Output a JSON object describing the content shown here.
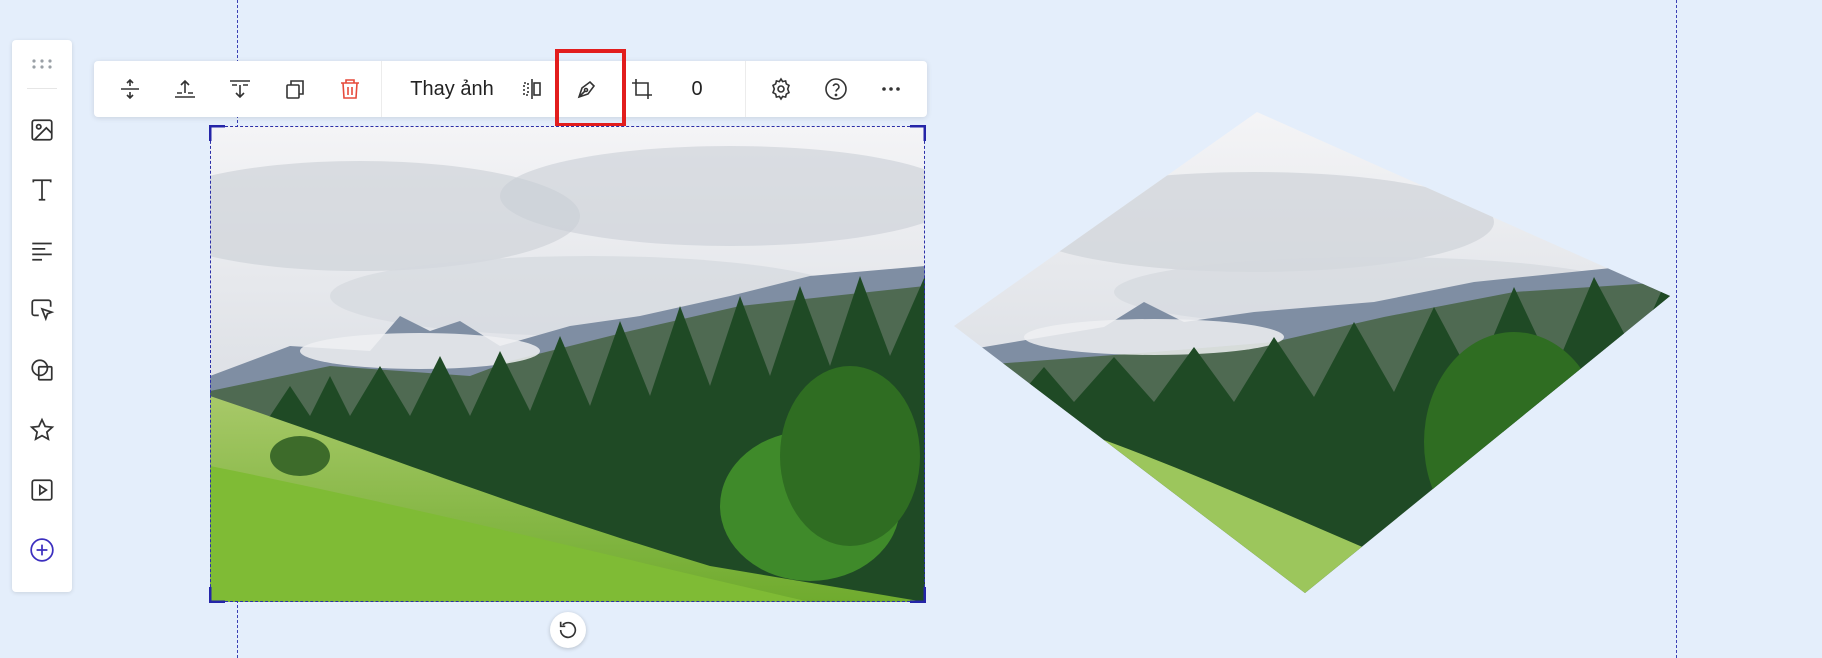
{
  "toolbar": {
    "replace_image_label": "Thay ảnh",
    "rotation_value": "0",
    "buttons": [
      {
        "icon": "resize-vertical-icon"
      },
      {
        "icon": "align-top-icon"
      },
      {
        "icon": "align-bottom-icon"
      },
      {
        "icon": "duplicate-icon"
      },
      {
        "icon": "trash-icon"
      },
      {
        "icon": "flip-horizontal-icon"
      },
      {
        "icon": "pen-tool-icon"
      },
      {
        "icon": "crop-icon"
      },
      {
        "icon": "gear-icon"
      },
      {
        "icon": "help-icon"
      },
      {
        "icon": "more-icon"
      }
    ]
  },
  "sidebar": {
    "items": [
      {
        "icon": "image-icon"
      },
      {
        "icon": "text-icon"
      },
      {
        "icon": "paragraph-icon"
      },
      {
        "icon": "button-cursor-icon"
      },
      {
        "icon": "shape-icon"
      },
      {
        "icon": "star-icon"
      },
      {
        "icon": "video-icon"
      },
      {
        "icon": "add-circle-icon"
      }
    ]
  },
  "colors": {
    "canvas_bg": "#e4eefb",
    "guide": "#3b40b5",
    "delete": "#e64a3b",
    "add": "#3c2fbf",
    "highlight": "#e21d1d"
  }
}
